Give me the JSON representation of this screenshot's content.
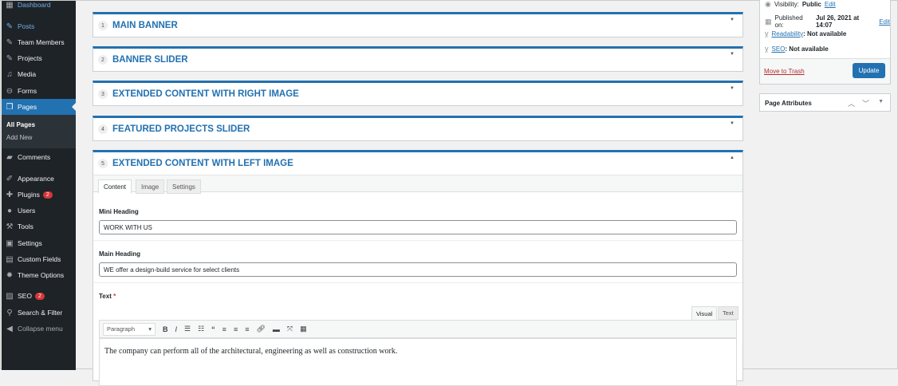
{
  "sidebar": {
    "items": [
      {
        "label": "Dashboard",
        "icon": "dashboard-icon"
      },
      {
        "label": "Posts",
        "icon": "pin-icon"
      },
      {
        "label": "Team Members",
        "icon": "pin-icon"
      },
      {
        "label": "Projects",
        "icon": "pin-icon"
      },
      {
        "label": "Media",
        "icon": "media-icon"
      },
      {
        "label": "Forms",
        "icon": "forms-icon"
      },
      {
        "label": "Pages",
        "icon": "pages-icon"
      },
      {
        "label": "Comments",
        "icon": "comment-icon"
      },
      {
        "label": "Appearance",
        "icon": "brush-icon"
      },
      {
        "label": "Plugins",
        "icon": "plugin-icon",
        "badge": "2"
      },
      {
        "label": "Users",
        "icon": "user-icon"
      },
      {
        "label": "Tools",
        "icon": "wrench-icon"
      },
      {
        "label": "Settings",
        "icon": "settings-icon"
      },
      {
        "label": "Custom Fields",
        "icon": "fields-icon"
      },
      {
        "label": "Theme Options",
        "icon": "gear-icon"
      },
      {
        "label": "SEO",
        "icon": "yoast-icon",
        "badge": "2"
      },
      {
        "label": "Search & Filter",
        "icon": "search-icon"
      },
      {
        "label": "Collapse menu",
        "icon": "collapse-icon"
      }
    ],
    "submenu": [
      "All Pages",
      "Add New"
    ]
  },
  "sections": [
    {
      "num": "1",
      "title": "MAIN BANNER"
    },
    {
      "num": "2",
      "title": "BANNER SLIDER"
    },
    {
      "num": "3",
      "title": "EXTENDED CONTENT WITH RIGHT IMAGE"
    },
    {
      "num": "4",
      "title": "FEATURED PROJECTS SLIDER"
    },
    {
      "num": "5",
      "title": "EXTENDED CONTENT WITH LEFT IMAGE"
    }
  ],
  "active_section": {
    "tabs": [
      "Content",
      "Image",
      "Settings"
    ],
    "active_tab": "Content",
    "mini_heading": {
      "label": "Mini Heading",
      "value": "WORK WITH US"
    },
    "main_heading": {
      "label": "Main Heading",
      "value": "WE offer a design-build service for select clients"
    },
    "text": {
      "label": "Text",
      "required": "*",
      "editor_tabs": [
        "Visual",
        "Text"
      ],
      "format": "Paragraph",
      "content": "The company can perform all of the architectural, engineering as well as construction work."
    }
  },
  "publish": {
    "visibility_label": "Visibility:",
    "visibility": "Public",
    "edit": "Edit",
    "published_label": "Published on:",
    "published": "Jul 26, 2021 at 14:07",
    "readability": "Readability",
    "readability_status": ": Not available",
    "seo": "SEO",
    "seo_status": ": Not available",
    "trash": "Move to Trash",
    "update": "Update"
  },
  "page_attributes": {
    "title": "Page Attributes"
  }
}
